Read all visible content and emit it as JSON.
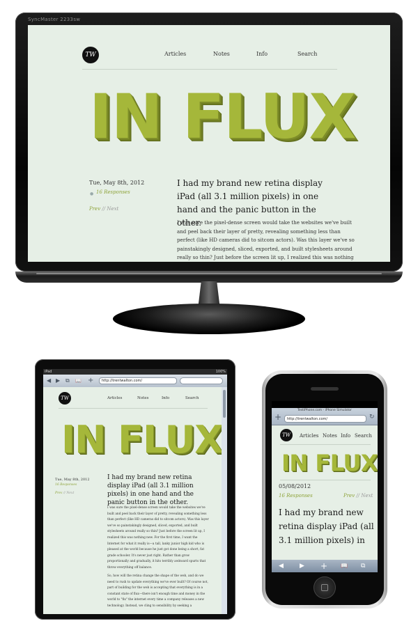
{
  "monitor": {
    "brand": "SyncMaster 2233sw"
  },
  "site": {
    "logo_text": "TW",
    "nav": [
      "Articles",
      "Notes",
      "Info",
      "Search"
    ],
    "hero_title": "IN FLUX",
    "post": {
      "date": "Tue, May 8th, 2012",
      "date_short": "05/08/2012",
      "responses": "16 Responses",
      "prev": "Prev",
      "separator": "//",
      "next": "Next",
      "lead": "I had my brand new retina display iPad (all 3.1 million pixels) in one hand and the panic button in the other.",
      "lead_phone": "I had my brand new retina display iPad (all 3.1 million pixels) in",
      "paragraph1": "I was sure the pixel-dense screen would take the websites we've built and peel back their layer of pretty, revealing something less than perfect (like HD cameras did to sitcom actors). Was this layer we've so painstakingly designed, sliced, exported, and built stylesheets around really so thin? Just before the screen lit up, I realized this was nothing new. For the first time, I want the Internet for what it really is—a tall, lanky junior high kid who is pleased at the world because he just got done being a short, fat grade schooler. It's never just right. Rather than grow proportionally and gradually, it hits terribly awkward spurts that throw everything off balance.",
      "paragraph2": "So, how will the retina change the shape of the web, and do we need to rush to update everything we've ever built? Of course not, part of building for the web is accepting that everything is in a constant state of flux—there isn't enough time and money in the world to \"fix\" the internet every time a company releases a new technology. Instead, we cling to sensibility by seeking a"
    }
  },
  "ipad": {
    "status_left": "iPad",
    "status_right": "100%",
    "url": "http://trentwalton.com/",
    "back": "◀",
    "forward": "▶",
    "pages": "⧉",
    "bookmarks": "📖",
    "add": "+"
  },
  "iphone": {
    "title": "TestiPhone.com - iPhone Simulator",
    "url": "http://trentwalton.com/",
    "add": "+",
    "reload": "↻",
    "back": "◀",
    "forward": "▶",
    "plus": "+",
    "book": "📖",
    "pages": "⧉"
  },
  "colors": {
    "page_bg": "#e6efe6",
    "accent_olive": "#a5b73a",
    "link_green": "#8ea33a"
  }
}
